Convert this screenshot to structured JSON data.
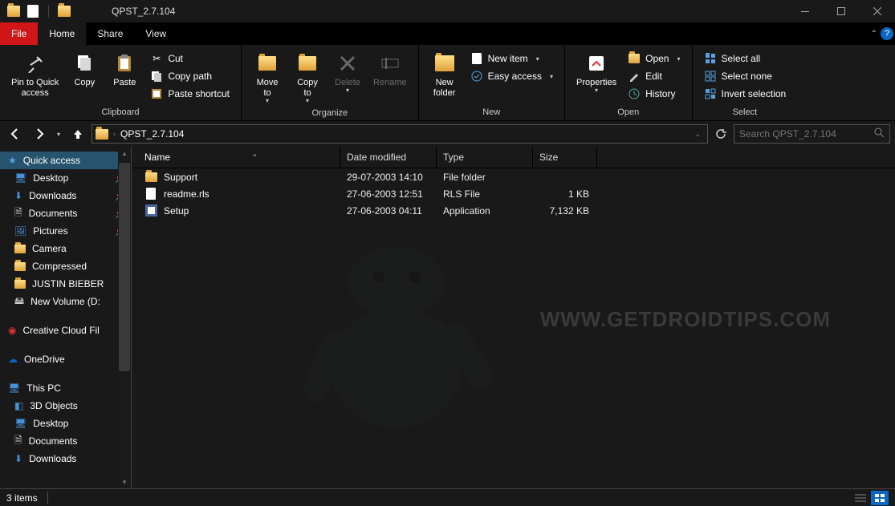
{
  "window": {
    "title": "QPST_2.7.104"
  },
  "tabs": {
    "file": "File",
    "home": "Home",
    "share": "Share",
    "view": "View"
  },
  "ribbon": {
    "clipboard": {
      "label": "Clipboard",
      "pin": "Pin to Quick\naccess",
      "copy": "Copy",
      "paste": "Paste",
      "cut": "Cut",
      "copy_path": "Copy path",
      "paste_shortcut": "Paste shortcut"
    },
    "organize": {
      "label": "Organize",
      "move_to": "Move\nto",
      "copy_to": "Copy\nto",
      "delete": "Delete",
      "rename": "Rename"
    },
    "new": {
      "label": "New",
      "new_folder": "New\nfolder",
      "new_item": "New item",
      "easy_access": "Easy access"
    },
    "open": {
      "label": "Open",
      "properties": "Properties",
      "open": "Open",
      "edit": "Edit",
      "history": "History"
    },
    "select": {
      "label": "Select",
      "select_all": "Select all",
      "select_none": "Select none",
      "invert": "Invert selection"
    }
  },
  "address": {
    "crumb": "QPST_2.7.104"
  },
  "search": {
    "placeholder": "Search QPST_2.7.104"
  },
  "sidebar": {
    "quick_access": "Quick access",
    "desktop": "Desktop",
    "downloads": "Downloads",
    "documents": "Documents",
    "pictures": "Pictures",
    "camera": "Camera",
    "compressed": "Compressed",
    "justin": "JUSTIN BIEBER",
    "newvol": "New Volume (D:",
    "ccf": "Creative Cloud Fil",
    "onedrive": "OneDrive",
    "thispc": "This PC",
    "objects3d": "3D Objects",
    "desktop2": "Desktop",
    "documents2": "Documents",
    "downloads2": "Downloads"
  },
  "columns": {
    "name": "Name",
    "date": "Date modified",
    "type": "Type",
    "size": "Size"
  },
  "rows": [
    {
      "name": "Support",
      "date": "29-07-2003 14:10",
      "type": "File folder",
      "size": "",
      "icon": "folder"
    },
    {
      "name": "readme.rls",
      "date": "27-06-2003 12:51",
      "type": "RLS File",
      "size": "1 KB",
      "icon": "doc"
    },
    {
      "name": "Setup",
      "date": "27-06-2003 04:11",
      "type": "Application",
      "size": "7,132 KB",
      "icon": "app"
    }
  ],
  "status": {
    "items": "3 items"
  },
  "watermark": "WWW.GETDROIDTIPS.COM"
}
